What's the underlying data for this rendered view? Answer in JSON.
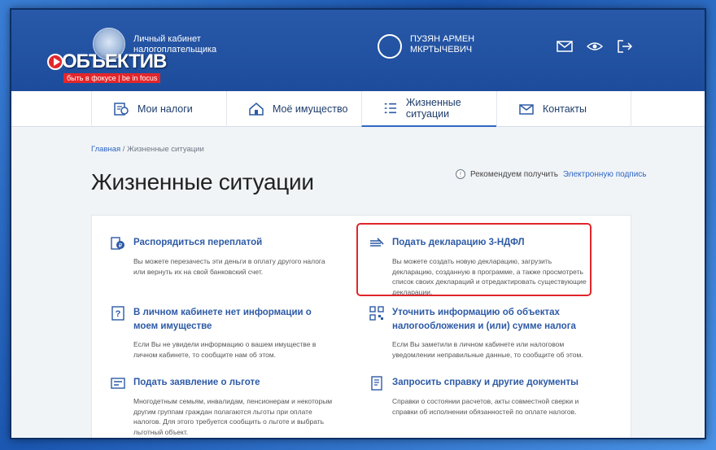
{
  "header": {
    "cabinet_title": "Личный кабинет налогоплательщика",
    "logo_text": "ОБЪЕКТИВ",
    "logo_tagline": "быть в фокусе | be in focus",
    "user_name": "ПУЗЯН АРМЕН МКРТЫЧЕВИЧ",
    "icons": [
      "mail-icon",
      "eye-icon",
      "logout-icon"
    ]
  },
  "nav": {
    "items": [
      {
        "label": "Мои налоги",
        "icon": "taxes-icon"
      },
      {
        "label": "Моё имущество",
        "icon": "property-icon"
      },
      {
        "label": "Жизненные ситуации",
        "icon": "list-icon"
      },
      {
        "label": "Контакты",
        "icon": "contacts-icon"
      }
    ],
    "active": "Жизненные ситуации"
  },
  "breadcrumb": {
    "home": "Главная",
    "separator": " / ",
    "current": "Жизненные ситуации"
  },
  "page": {
    "title": "Жизненные ситуации",
    "recommend_text": "Рекомендуем получить",
    "recommend_link": "Электронную подпись"
  },
  "situations": [
    {
      "title": "Распорядиться переплатой",
      "desc": "Вы можете перезачесть эти деньги в оплату другого налога или вернуть их на свой банковский счет.",
      "icon": "coin-icon"
    },
    {
      "title": "Подать декларацию 3-НДФЛ",
      "desc": "Вы можете создать новую декларацию, загрузить декларацию, созданную в программе, а также просмотреть список своих деклараций и отредактировать существующие декларации.",
      "icon": "declaration-icon"
    },
    {
      "title": "В личном кабинете нет информации о моем имуществе",
      "desc": "Если Вы не увидели информацию о вашем имуществе в личном кабинете, то сообщите нам об этом.",
      "icon": "question-icon"
    },
    {
      "title": "Уточнить информацию об объектах налогообложения и (или) сумме налога",
      "desc": "Если Вы заметили в личном кабинете или налоговом уведомлении неправильные данные, то сообщите об этом.",
      "icon": "qr-icon"
    },
    {
      "title": "Подать заявление о льготе",
      "desc": "Многодетным семьям, инвалидам, пенсионерам и некоторым другим группам граждан полагаются льготы при оплате налогов. Для этого требуется сообщить о льготе и выбрать льготный объект.",
      "icon": "benefit-icon"
    },
    {
      "title": "Запросить справку и другие документы",
      "desc": "Справки о состоянии расчетов, акты совместной сверки и справки об исполнении обязанностей по оплате налогов.",
      "icon": "document-icon"
    }
  ],
  "colors": {
    "header": "#1d4c9c",
    "accent": "#2d66c4",
    "highlight": "#e0252b"
  }
}
